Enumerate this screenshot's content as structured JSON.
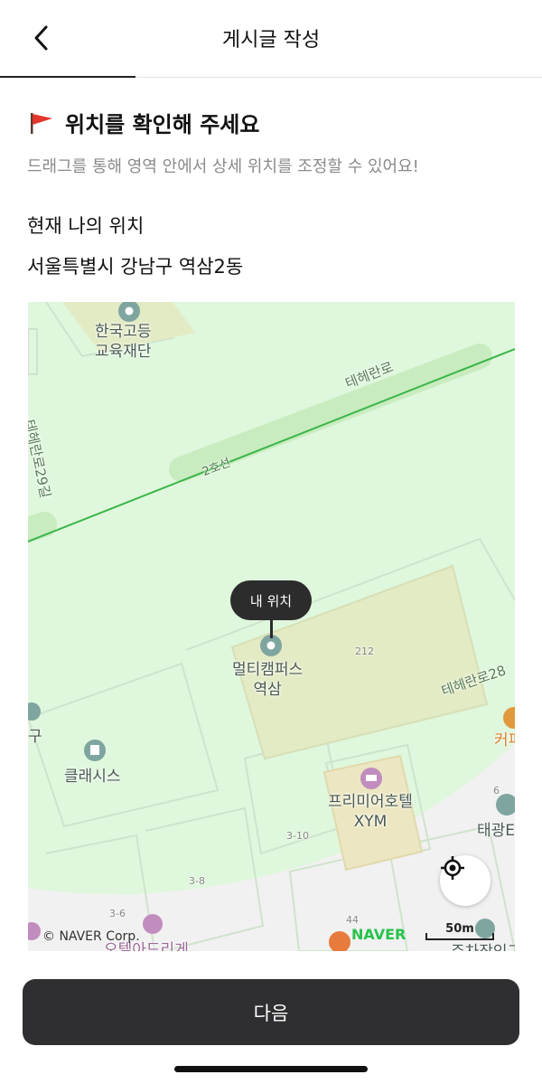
{
  "header": {
    "title": "게시글 작성",
    "back_icon": "chevron-left-icon",
    "progress": 0.25
  },
  "section": {
    "flag_icon": "red-flag-icon",
    "title": "위치를 확인해 주세요",
    "description": "드래그를 통해 영역 안에서 상세 위치를 조정할 수 있어요!"
  },
  "location": {
    "label": "현재 나의 위치",
    "address": "서울특별시 강남구 역삼2동"
  },
  "map": {
    "my_location_label": "내 위치",
    "places": {
      "korea_foundation": "한국고등\n교육재단",
      "multicampus": "멀티캠퍼스\n역삼",
      "classis": "클래시스",
      "premier_hotel": "프리미어호텔\nXYM",
      "taegwang": "태광E",
      "coffee": "커피",
      "gu": "구",
      "hotel_bottom": "오텔아드리게",
      "parking": "주차장인그"
    },
    "roads": {
      "teheran": "테헤란로",
      "teheran29": "테헤란로29길",
      "teheran28": "테헤란로28",
      "line2": "2호선"
    },
    "lot_numbers": {
      "a": "212",
      "b": "3-10",
      "c": "3-8",
      "d": "3-6",
      "e": "44",
      "f": "6"
    },
    "copyright": "© NAVER Corp.",
    "provider": "NAVER",
    "scale": "50m",
    "locate_icon": "crosshair-icon",
    "colors": {
      "radius_fill": "#dff7dc",
      "subway": "#3bb54a",
      "road": "#c8ecbf"
    }
  },
  "footer": {
    "next_label": "다음"
  }
}
